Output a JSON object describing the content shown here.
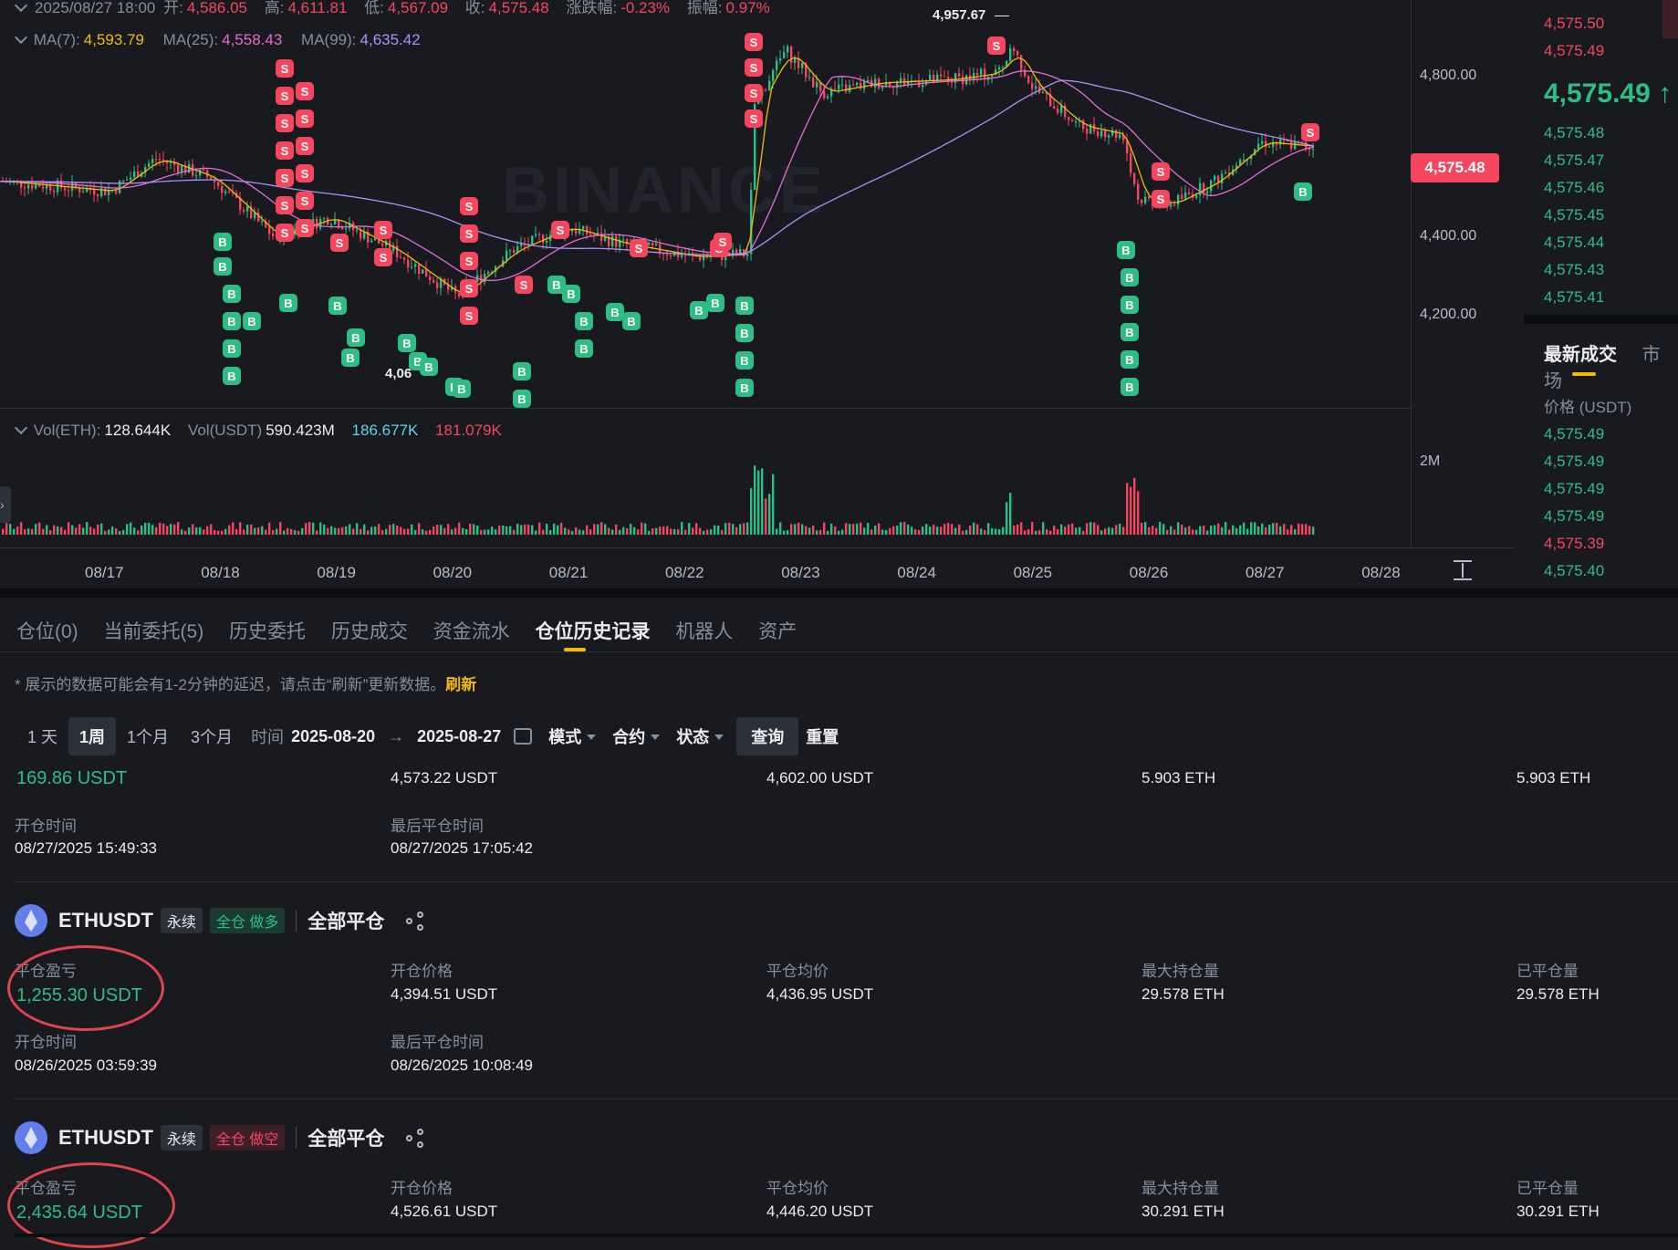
{
  "kline_info": {
    "datetime": "2025/08/27 18:00",
    "open_label": "开:",
    "open": "4,586.05",
    "high_label": "高:",
    "high": "4,611.81",
    "low_label": "低:",
    "low": "4,567.09",
    "close_label": "收:",
    "close": "4,575.48",
    "change_label": "涨跌幅:",
    "change": "-0.23%",
    "amp_label": "振幅:",
    "amp": "0.97%"
  },
  "ma": {
    "ma7_label": "MA(7):",
    "ma7": "4,593.79",
    "ma25_label": "MA(25):",
    "ma25": "4,558.43",
    "ma99_label": "MA(99):",
    "ma99": "4,635.42",
    "colors": {
      "ma7": "#f0b90b",
      "ma25": "#e66cd1",
      "ma99": "#b090f5"
    }
  },
  "volume": {
    "eth_label": "Vol(ETH):",
    "eth": "128.644K",
    "usdt_label": "Vol(USDT)",
    "usdt": "590.423M",
    "buy": "186.677K",
    "sell": "181.079K",
    "axis_label": "2M"
  },
  "chart": {
    "watermark": "BINANCE",
    "peak_label": "4,957.67",
    "low_label": "4,06",
    "price_ticks": [
      "4,800.00",
      "4,400.00",
      "4,200.00"
    ],
    "current_price_tag": "4,575.48",
    "date_ticks": [
      "08/17",
      "08/18",
      "08/19",
      "08/20",
      "08/21",
      "08/22",
      "08/23",
      "08/24",
      "08/25",
      "08/26",
      "08/27",
      "08/28"
    ],
    "marker_sell": "S",
    "marker_buy": "B",
    "colors": {
      "up": "#2ebd85",
      "down": "#f6465d",
      "bg": "#181a20"
    }
  },
  "orderbook": {
    "asks": [
      "4,575.50",
      "4,575.49"
    ],
    "last_price": "4,575.49",
    "last_arrow": "↑",
    "bids": [
      "4,575.48",
      "4,575.47",
      "4,575.46",
      "4,575.45",
      "4,575.44",
      "4,575.43",
      "4,575.41"
    ]
  },
  "trades_panel": {
    "tab_active": "最新成交",
    "tab_other": "市场",
    "price_header": "价格 (USDT)",
    "prices": [
      {
        "p": "4,575.49",
        "side": "buy"
      },
      {
        "p": "4,575.49",
        "side": "buy"
      },
      {
        "p": "4,575.49",
        "side": "buy"
      },
      {
        "p": "4,575.49",
        "side": "buy"
      },
      {
        "p": "4,575.39",
        "side": "sell"
      },
      {
        "p": "4,575.40",
        "side": "buy"
      }
    ]
  },
  "tabs": [
    "仓位(0)",
    "当前委托(5)",
    "历史委托",
    "历史成交",
    "资金流水",
    "仓位历史记录",
    "机器人",
    "资产"
  ],
  "notice": {
    "text": "* 展示的数据可能会有1-2分钟的延迟，请点击“刷新”更新数据。",
    "refresh": "刷新"
  },
  "filters": {
    "ranges": [
      "1 天",
      "1周",
      "1个月",
      "3个月"
    ],
    "time_label": "时间",
    "start": "2025-08-20",
    "end": "2025-08-27",
    "mode": "模式",
    "contract": "合约",
    "status": "状态",
    "query": "查询",
    "reset": "重置"
  },
  "positions": [
    {
      "symbol": "",
      "perp": "",
      "side": "",
      "pnl": "169.86 USDT",
      "open_price": "4,573.22 USDT",
      "close_avg": "4,602.00 USDT",
      "max_size": "5.903 ETH",
      "closed_size": "5.903 ETH",
      "open_time_label": "开仓时间",
      "open_time": "08/27/2025 15:49:33",
      "close_time_label": "最后平仓时间",
      "close_time": "08/27/2025 17:05:42"
    },
    {
      "symbol": "ETHUSDT",
      "perp": "永续",
      "side": "全仓 做多",
      "side_type": "long",
      "close_all": "全部平仓",
      "pnl_label": "平仓盈亏",
      "pnl": "1,255.30 USDT",
      "open_price_label": "开仓价格",
      "open_price": "4,394.51 USDT",
      "close_avg_label": "平仓均价",
      "close_avg": "4,436.95 USDT",
      "max_size_label": "最大持仓量",
      "max_size": "29.578 ETH",
      "closed_size_label": "已平仓量",
      "closed_size": "29.578 ETH",
      "open_time_label": "开仓时间",
      "open_time": "08/26/2025 03:59:39",
      "close_time_label": "最后平仓时间",
      "close_time": "08/26/2025 10:08:49"
    },
    {
      "symbol": "ETHUSDT",
      "perp": "永续",
      "side": "全仓 做空",
      "side_type": "short",
      "close_all": "全部平仓",
      "pnl_label": "平仓盈亏",
      "pnl": "2,435.64 USDT",
      "open_price_label": "开仓价格",
      "open_price": "4,526.61 USDT",
      "close_avg_label": "平仓均价",
      "close_avg": "4,446.20 USDT",
      "max_size_label": "最大持仓量",
      "max_size": "30.291 ETH",
      "closed_size_label": "已平仓量",
      "closed_size": "30.291 ETH"
    }
  ]
}
